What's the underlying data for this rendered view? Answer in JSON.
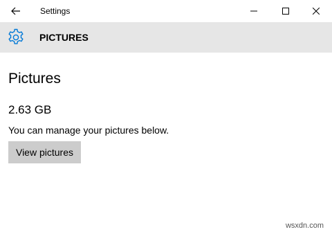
{
  "titlebar": {
    "title": "Settings",
    "back_icon": "back-arrow-icon",
    "minimize_icon": "minimize-icon",
    "maximize_icon": "maximize-icon",
    "close_icon": "close-icon"
  },
  "header": {
    "icon": "gear-icon",
    "title": "PICTURES",
    "background": "#e6e6e6",
    "accent": "#0078d7"
  },
  "main": {
    "heading": "Pictures",
    "size": "2.63 GB",
    "description": "You can manage your pictures below.",
    "button_label": "View pictures",
    "button_background": "#cccccc"
  },
  "watermark": "wsxdn.com"
}
